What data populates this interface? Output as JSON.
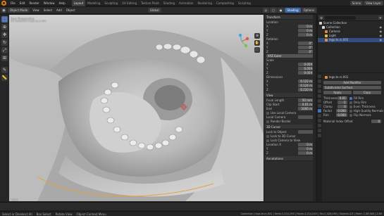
{
  "topbar": {
    "menus": [
      "File",
      "Edit",
      "Render",
      "Window",
      "Help"
    ],
    "workspaces": [
      "Layout",
      "Modeling",
      "Sculpting",
      "UV Editing",
      "Texture Paint",
      "Shading",
      "Animation",
      "Rendering",
      "Compositing",
      "Scripting"
    ],
    "active_workspace": "Layout",
    "scene_label": "Scene",
    "view_layer_label": "View Layer"
  },
  "header3d": {
    "mode": "Object Mode",
    "menus": [
      "View",
      "Select",
      "Add",
      "Object"
    ],
    "transform": "Global",
    "right_buttons": [
      "Options",
      "Shading"
    ]
  },
  "viewport": {
    "view_name": "User Perspective",
    "collection_path": "(1) Collection | legs.te.rs.001",
    "status_text": "Rotate"
  },
  "npanel": {
    "sections": [
      {
        "title": "Transform",
        "fields": [
          {
            "label": "Location",
            "value": ""
          },
          {
            "label": "X",
            "value": "0 m"
          },
          {
            "label": "Y",
            "value": "0 m"
          },
          {
            "label": "Z",
            "value": "0 m"
          },
          {
            "label": "Rotation",
            "value": ""
          },
          {
            "label": "X",
            "value": "0°"
          },
          {
            "label": "Y",
            "value": "0°"
          },
          {
            "label": "Z",
            "value": "0°"
          },
          {
            "label": "XYZ Euler",
            "value": ""
          },
          {
            "label": "Scale",
            "value": ""
          },
          {
            "label": "X",
            "value": "0.059"
          },
          {
            "label": "Y",
            "value": "0.059"
          },
          {
            "label": "Z",
            "value": "0.059"
          },
          {
            "label": "Dimensions",
            "value": ""
          },
          {
            "label": "X",
            "value": "0.122 m"
          },
          {
            "label": "Y",
            "value": "0.124 m"
          },
          {
            "label": "Z",
            "value": "0.110 m"
          }
        ]
      },
      {
        "title": "View",
        "fields": [
          {
            "label": "Focal Length",
            "value": "50 mm"
          },
          {
            "label": "Clip Start",
            "value": "0.01 m"
          },
          {
            "label": "End",
            "value": "1000 m"
          },
          {
            "label": "Use Local Camera",
            "value": ""
          },
          {
            "label": "Local Camera",
            "value": ""
          },
          {
            "label": "Render Border",
            "value": ""
          }
        ]
      },
      {
        "title": "3D Cursor",
        "fields": [
          {
            "label": "Lock to Object",
            "value": ""
          },
          {
            "label": "Lock to 3D Cursor",
            "value": ""
          },
          {
            "label": "Lock Camera to View",
            "value": ""
          },
          {
            "label": "Location X",
            "value": "0 m"
          },
          {
            "label": "Y",
            "value": "0 m"
          },
          {
            "label": "Z",
            "value": "0 m"
          }
        ]
      },
      {
        "title": "Annotations",
        "fields": []
      }
    ]
  },
  "outliner": {
    "title": "Scene Collection",
    "rows": [
      {
        "label": "Scene Collection",
        "color": "#cfcfcf",
        "selected": false
      },
      {
        "label": "Collection",
        "color": "#d9d9d9",
        "selected": false
      },
      {
        "label": "Camera",
        "color": "#e0863e",
        "selected": false
      },
      {
        "label": "Light",
        "color": "#e0c23e",
        "selected": false
      },
      {
        "label": "legs.te.rs.001",
        "color": "#e08b3e",
        "selected": true
      }
    ]
  },
  "props": {
    "object_name": "legs.te.rs.001",
    "modifier": "Add Modifier",
    "modifier_tabs": [
      "Apply",
      "Copy"
    ],
    "subdiv_label": "Subdivision Surface",
    "fields": [
      {
        "label": "Thickness",
        "value": "0.01 m"
      },
      {
        "label": "Offset",
        "value": "-1"
      },
      {
        "label": "Clamp",
        "value": "0"
      },
      {
        "label": "Factor",
        "value": "0.000"
      },
      {
        "label": "Rim",
        "value": "0.000"
      }
    ],
    "checks": [
      {
        "label": "Fill Rim",
        "on": true
      },
      {
        "label": "Only Rim",
        "on": false
      },
      {
        "label": "Even Thickness",
        "on": false
      },
      {
        "label": "High Quality Normals",
        "on": false
      },
      {
        "label": "Flip Normals",
        "on": false
      }
    ],
    "footer_label": "Material Index Offset",
    "footer_value": "0"
  },
  "statusbar": {
    "left_items": [
      "Select or Deselect All",
      "Box Select",
      "Rotate View",
      "Object Context Menu"
    ],
    "right_text": "Collection | legs.te.rs.001 | Verts:1,214,295 | Faces:1,214,245 | Tris:2,428,490 | Objects:1/3 | Mem: 1.58 GiB | 2.80"
  },
  "colors": {
    "accent": "#4772b3",
    "active_object_outline": "#e8a23d",
    "viewport_clay": "#c4c4c4"
  }
}
